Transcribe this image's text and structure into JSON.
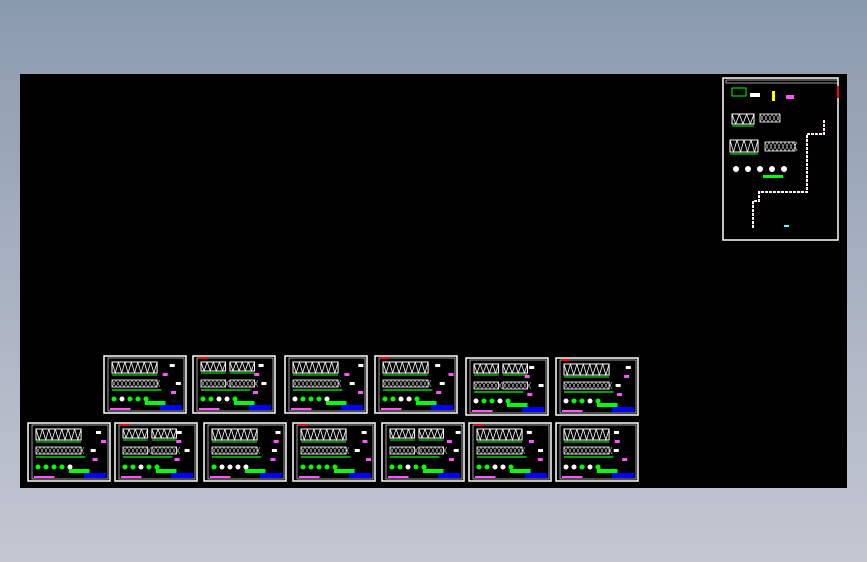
{
  "viewport": {
    "background": "#000000"
  },
  "colors": {
    "frame": "#ffffff",
    "truss": "#ffffff",
    "dim": "#00ff00",
    "note": "#ff55ff",
    "title_block": "#0000ff",
    "accent": "#ff0000"
  },
  "sheets_row1_count": 6,
  "sheets_row2_count": 7,
  "overview_sheet_count": 1
}
